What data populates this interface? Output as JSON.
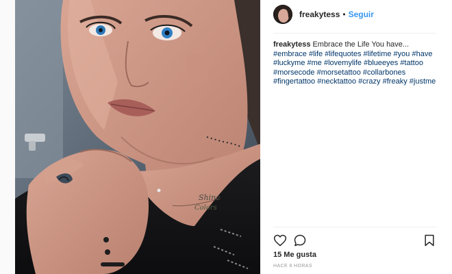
{
  "post": {
    "username": "freakytess",
    "separator": "•",
    "follow_label": "Seguir",
    "caption_author": "freakytess",
    "caption_text": "Embrace the Life You have...",
    "hashtags": [
      "#embrace",
      "#life",
      "#lifequotes",
      "#lifetime",
      "#you",
      "#have",
      "#luckyme",
      "#me",
      "#lovemylife",
      "#blueeyes",
      "#tattoo",
      "#morsecode",
      "#morsetattoo",
      "#collarbones",
      "#fingertattoo",
      "#necktattoo",
      "#crazy",
      "#freaky",
      "#justme"
    ],
    "likes_label": "15 Me gusta",
    "timestamp": "HACE 8 HORAS"
  },
  "photo": {
    "tattoo_line1": "Shine",
    "tattoo_line2": "Colors"
  },
  "icons": {
    "like": "heart-icon",
    "comment": "comment-icon",
    "save": "bookmark-icon"
  },
  "colors": {
    "link": "#003569",
    "follow": "#3897f0",
    "text": "#262626",
    "muted": "#999999"
  }
}
